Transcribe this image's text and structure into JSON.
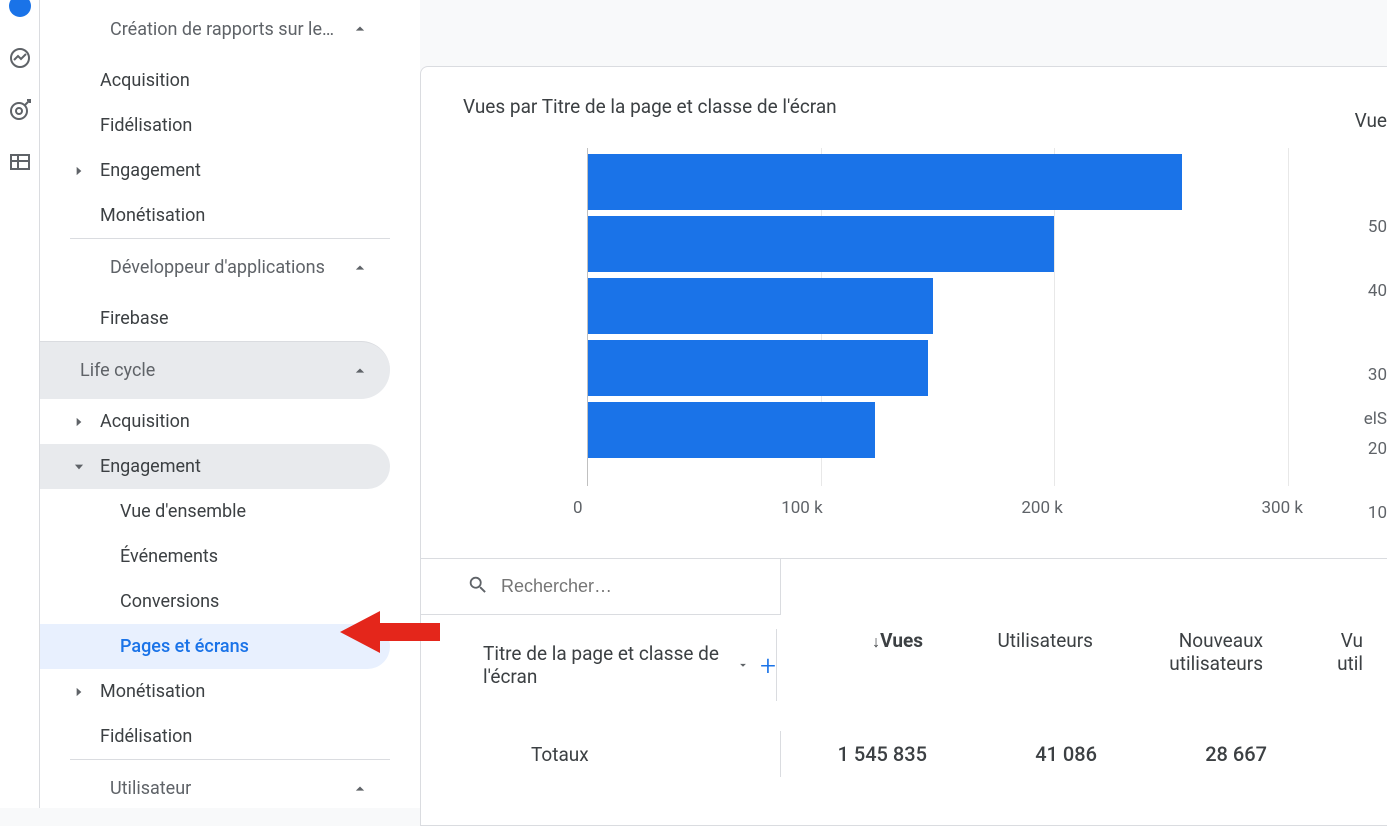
{
  "rail": {
    "icons": [
      "home",
      "trends",
      "target",
      "table"
    ]
  },
  "sidebar": {
    "section1": {
      "label": "Création de rapports sur le…",
      "items": [
        {
          "label": "Acquisition"
        },
        {
          "label": "Fidélisation"
        },
        {
          "label": "Engagement",
          "has_children": true
        },
        {
          "label": "Monétisation"
        }
      ]
    },
    "section2": {
      "label": "Développeur d'applications",
      "items": [
        {
          "label": "Firebase"
        }
      ]
    },
    "section3": {
      "label": "Life cycle",
      "items": [
        {
          "label": "Acquisition",
          "has_children": true
        },
        {
          "label": "Engagement",
          "has_children": true,
          "expanded": true,
          "children": [
            {
              "label": "Vue d'ensemble"
            },
            {
              "label": "Événements"
            },
            {
              "label": "Conversions"
            },
            {
              "label": "Pages et écrans",
              "active": true
            }
          ]
        },
        {
          "label": "Monétisation",
          "has_children": true
        },
        {
          "label": "Fidélisation"
        }
      ]
    },
    "section4": {
      "label": "Utilisateur"
    }
  },
  "chart": {
    "title": "Vues par Titre de la page et classe de l'écran",
    "xticks": [
      "0",
      "100 k",
      "200 k",
      "300 k"
    ]
  },
  "right_chart": {
    "title_fragment": "Vue",
    "yticks": [
      "50",
      "40",
      "30",
      "elS",
      "20",
      "10"
    ]
  },
  "chart_data": {
    "type": "bar",
    "orientation": "horizontal",
    "title": "Vues par Titre de la page et classe de l'écran",
    "xlabel": "",
    "ylabel": "",
    "xlim": [
      0,
      300000
    ],
    "categories": [
      "",
      "",
      "",
      "",
      ""
    ],
    "values": [
      255000,
      200000,
      148000,
      146000,
      123000
    ]
  },
  "table": {
    "search_placeholder": "Rechercher…",
    "dimension_label": "Titre de la page et classe de l'écran",
    "columns": [
      "Vues",
      "Utilisateurs",
      "Nouveaux utilisateurs",
      "Vu",
      "util"
    ],
    "col3_line1": "Nouveaux",
    "col3_line2": "utilisateurs",
    "col4_line1": "Vu",
    "col4_line2": "util",
    "totals_label": "Totaux",
    "totals": [
      "1 545 835",
      "41 086",
      "28 667"
    ]
  }
}
